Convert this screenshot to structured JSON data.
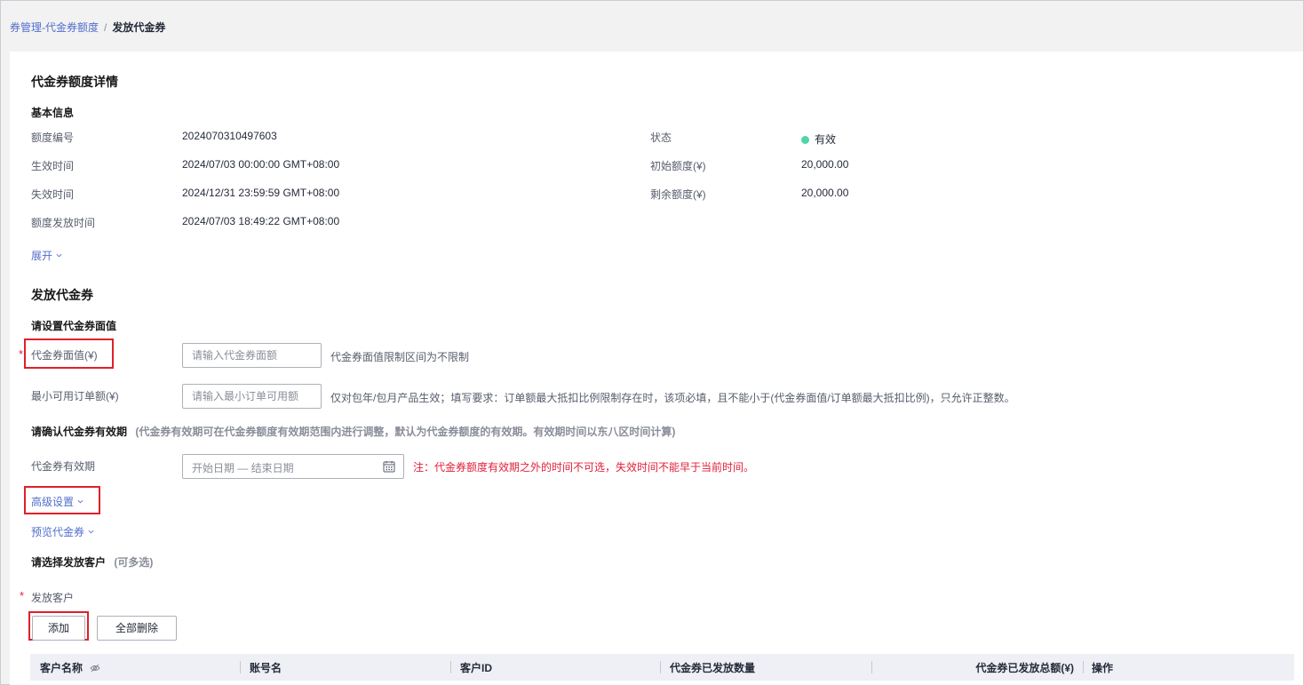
{
  "breadcrumb": {
    "parent": "券管理-代金券额度",
    "separator": "/",
    "current": "发放代金券"
  },
  "detail": {
    "title": "代金券额度详情",
    "basic_info_title": "基本信息",
    "fields": {
      "quota_no_label": "额度编号",
      "quota_no_value": "2024070310497603",
      "effective_label": "生效时间",
      "effective_value": "2024/07/03 00:00:00 GMT+08:00",
      "expire_label": "失效时间",
      "expire_value": "2024/12/31 23:59:59 GMT+08:00",
      "issued_label": "额度发放时间",
      "issued_value": "2024/07/03 18:49:22 GMT+08:00",
      "status_label": "状态",
      "status_value": "有效",
      "initial_label": "初始额度(¥)",
      "initial_value": "20,000.00",
      "remaining_label": "剩余额度(¥)",
      "remaining_value": "20,000.00"
    },
    "expand_label": "展开"
  },
  "issue": {
    "title": "发放代金券",
    "face_value_section": "请设置代金券面值",
    "face_value_label": "代金券面值(¥)",
    "face_value_placeholder": "请输入代金券面额",
    "face_value_hint": "代金券面值限制区间为不限制",
    "min_order_label": "最小可用订单额(¥)",
    "min_order_placeholder": "请输入最小订单可用额",
    "min_order_hint": "仅对包年/包月产品生效；填写要求：订单额最大抵扣比例限制存在时，该项必填，且不能小于(代金券面值/订单额最大抵扣比例)，只允许正整数。",
    "validity_section": "请确认代金券有效期",
    "validity_section_hint": "(代金券有效期可在代金券额度有效期范围内进行调整，默认为代金券额度的有效期。有效期时间以东八区时间计算)",
    "validity_label": "代金券有效期",
    "validity_placeholder": "开始日期 — 结束日期",
    "validity_note": "注：代金券额度有效期之外的时间不可选，失效时间不能早于当前时间。",
    "advanced_label": "高级设置",
    "preview_label": "预览代金券",
    "customer_section": "请选择发放客户",
    "customer_section_hint": "(可多选)",
    "customer_label": "发放客户",
    "add_button": "添加",
    "delete_all_button": "全部删除"
  },
  "table": {
    "columns": [
      "客户名称",
      "账号名",
      "客户ID",
      "代金券已发放数量",
      "代金券已发放总额(¥)",
      "操作"
    ]
  },
  "colors": {
    "link": "#526ecc",
    "status_ok": "#50d4ab",
    "warning": "#e0203a",
    "highlight_box": "#e0202a"
  }
}
